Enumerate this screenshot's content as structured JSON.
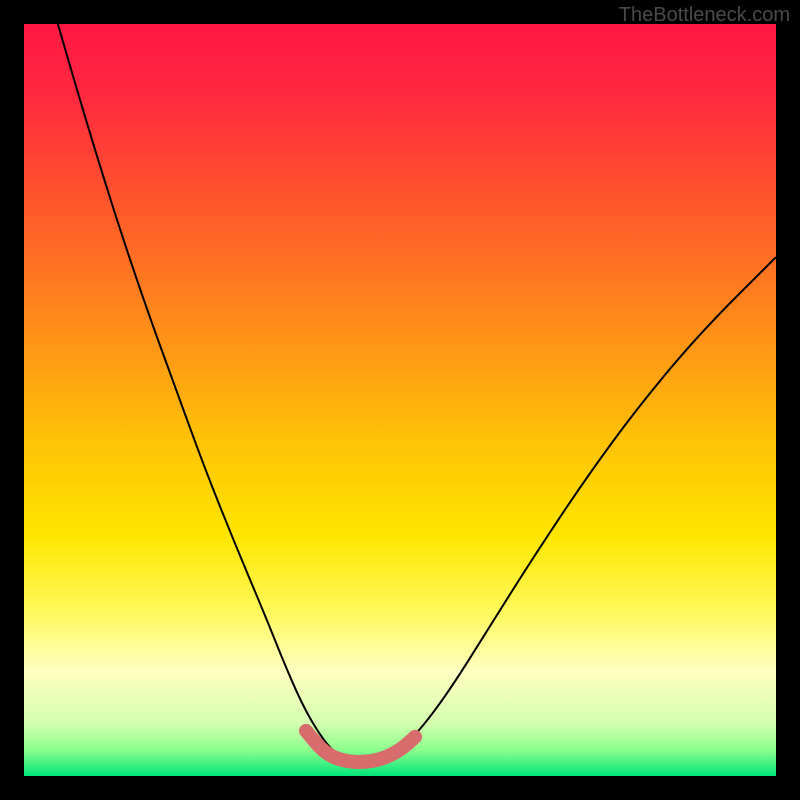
{
  "watermark": "TheBottleneck.com",
  "chart_data": {
    "type": "line",
    "title": "",
    "xlabel": "",
    "ylabel": "",
    "xlim": [
      0,
      100
    ],
    "ylim": [
      0,
      100
    ],
    "gradient_stops": [
      {
        "offset": 0.0,
        "color": "#ff1744"
      },
      {
        "offset": 0.1,
        "color": "#ff2a3f"
      },
      {
        "offset": 0.25,
        "color": "#ff5a2a"
      },
      {
        "offset": 0.4,
        "color": "#ff8c1a"
      },
      {
        "offset": 0.55,
        "color": "#ffc107"
      },
      {
        "offset": 0.68,
        "color": "#ffe600"
      },
      {
        "offset": 0.78,
        "color": "#fff95a"
      },
      {
        "offset": 0.86,
        "color": "#ffffc0"
      },
      {
        "offset": 0.93,
        "color": "#d4ffb0"
      },
      {
        "offset": 0.965,
        "color": "#8dff8d"
      },
      {
        "offset": 1.0,
        "color": "#00e67a"
      }
    ],
    "series": [
      {
        "name": "bottleneck-curve",
        "color": "#000000",
        "stroke_width": 2,
        "points": [
          {
            "x": 4.5,
            "y": 100.0
          },
          {
            "x": 8.0,
            "y": 88.0
          },
          {
            "x": 12.0,
            "y": 75.0
          },
          {
            "x": 16.0,
            "y": 63.0
          },
          {
            "x": 20.0,
            "y": 52.0
          },
          {
            "x": 24.0,
            "y": 41.0
          },
          {
            "x": 28.0,
            "y": 31.0
          },
          {
            "x": 32.0,
            "y": 21.5
          },
          {
            "x": 35.0,
            "y": 14.0
          },
          {
            "x": 37.5,
            "y": 8.5
          },
          {
            "x": 40.0,
            "y": 4.5
          },
          {
            "x": 42.0,
            "y": 2.5
          },
          {
            "x": 44.0,
            "y": 1.8
          },
          {
            "x": 46.0,
            "y": 1.8
          },
          {
            "x": 48.0,
            "y": 2.3
          },
          {
            "x": 50.0,
            "y": 3.5
          },
          {
            "x": 53.0,
            "y": 6.5
          },
          {
            "x": 57.0,
            "y": 12.0
          },
          {
            "x": 62.0,
            "y": 20.0
          },
          {
            "x": 68.0,
            "y": 29.5
          },
          {
            "x": 75.0,
            "y": 40.0
          },
          {
            "x": 82.0,
            "y": 49.5
          },
          {
            "x": 90.0,
            "y": 59.0
          },
          {
            "x": 100.0,
            "y": 69.0
          }
        ]
      },
      {
        "name": "highlight-segment",
        "color": "#d86b6b",
        "stroke_width": 14,
        "linecap": "round",
        "points": [
          {
            "x": 37.5,
            "y": 6.0
          },
          {
            "x": 40.0,
            "y": 3.0
          },
          {
            "x": 42.5,
            "y": 2.0
          },
          {
            "x": 45.0,
            "y": 1.8
          },
          {
            "x": 47.5,
            "y": 2.2
          },
          {
            "x": 50.0,
            "y": 3.4
          },
          {
            "x": 52.0,
            "y": 5.2
          }
        ]
      }
    ]
  }
}
